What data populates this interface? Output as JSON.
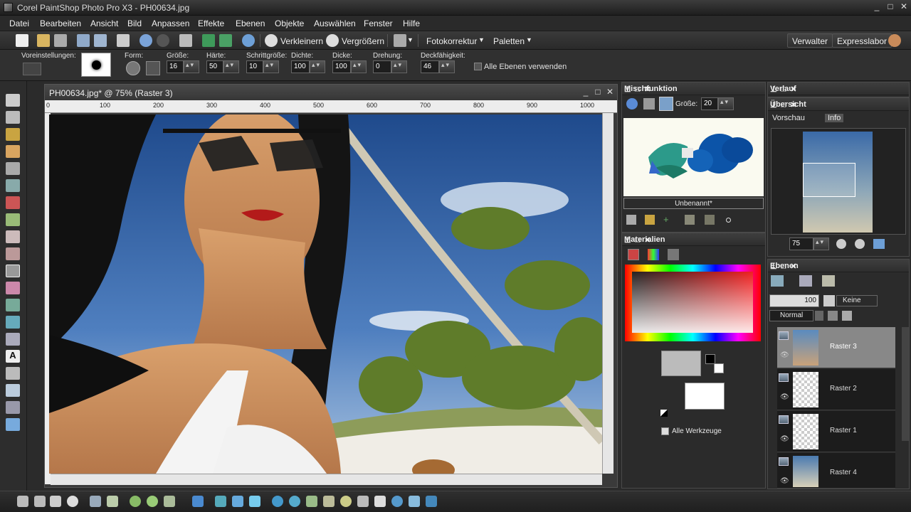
{
  "window": {
    "title": "Corel PaintShop Photo Pro X3 - PH00634.jpg",
    "controls": [
      "_",
      "□",
      "✕"
    ]
  },
  "menu": [
    "Datei",
    "Bearbeiten",
    "Ansicht",
    "Bild",
    "Anpassen",
    "Effekte",
    "Ebenen",
    "Objekte",
    "Auswählen",
    "Fenster",
    "Hilfe"
  ],
  "toolbar": {
    "zoom_out": "Verkleinern",
    "zoom_in": "Vergrößern",
    "photo_fix": "Fotokorrektur",
    "palettes": "Paletten",
    "manager": "Verwalter",
    "express": "Expresslabor"
  },
  "options": {
    "presets_label": "Voreinstellungen:",
    "form_label": "Form:",
    "size_label": "Größe:",
    "size": "16",
    "hardness_label": "Härte:",
    "hardness": "50",
    "step_label": "Schrittgröße:",
    "step": "10",
    "density_label": "Dichte:",
    "density": "100",
    "thickness_label": "Dicke:",
    "thickness": "100",
    "rotation_label": "Drehung:",
    "rotation": "0",
    "opacity_label": "Deckfähigkeit:",
    "opacity": "46",
    "all_layers": "Alle Ebenen verwenden"
  },
  "document": {
    "title": "PH00634.jpg* @  75% (Raster 3)",
    "ruler": [
      "0",
      "100",
      "200",
      "300",
      "400",
      "500",
      "600",
      "700",
      "800",
      "900",
      "1000"
    ]
  },
  "mix": {
    "title": "Mischfunktion",
    "size_label": "Größe:",
    "size": "20",
    "canvas_name": "Unbenannt*"
  },
  "materials": {
    "title": "Materialien",
    "all_tools": "Alle Werkzeuge"
  },
  "history": {
    "title": "Verlauf"
  },
  "overview": {
    "title": "Übersicht",
    "tab_preview": "Vorschau",
    "tab_info": "Info",
    "zoom": "75"
  },
  "layers": {
    "title": "Ebenen",
    "opacity": "100",
    "mask": "Keine",
    "blend": "Normal",
    "items": [
      {
        "name": "Raster 3",
        "selected": true
      },
      {
        "name": "Raster 2",
        "selected": false
      },
      {
        "name": "Raster 1",
        "selected": false
      },
      {
        "name": "Raster 4",
        "selected": false
      }
    ]
  },
  "colors": {
    "accent": "#6d9fd6",
    "selected_layer": "#888888"
  }
}
